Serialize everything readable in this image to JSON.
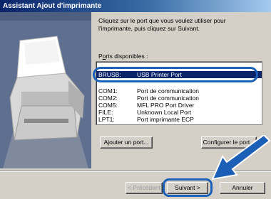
{
  "window": {
    "title": "Assistant Ajout d'imprimante"
  },
  "instruction": "Cliquez sur le port que vous voulez utiliser pour l'imprimante, puis cliquez sur Suivant.",
  "ports_label": {
    "prefix": "P",
    "underlined": "o",
    "suffix": "rts disponibles :"
  },
  "ports": [
    {
      "port": "BRUSB:",
      "desc": "USB Printer Port",
      "selected": true
    },
    {
      "port": "COM1:",
      "desc": "Port de communication"
    },
    {
      "port": "COM2:",
      "desc": "Port de communication"
    },
    {
      "port": "COM5:",
      "desc": "MFL PRO Port Driver"
    },
    {
      "port": "FILE:",
      "desc": "Unknown Local Port"
    },
    {
      "port": "LPT1:",
      "desc": "Port imprimante ECP"
    }
  ],
  "buttons": {
    "add_port": "Ajouter un port...",
    "configure_port": "Configurer le port...",
    "previous": "< Précédent",
    "next": "Suivant >",
    "cancel": "Annuler"
  },
  "colors": {
    "accent_ring": "#1c5fb6",
    "selection": "#0a246a",
    "title_bar": "#0a246a"
  }
}
